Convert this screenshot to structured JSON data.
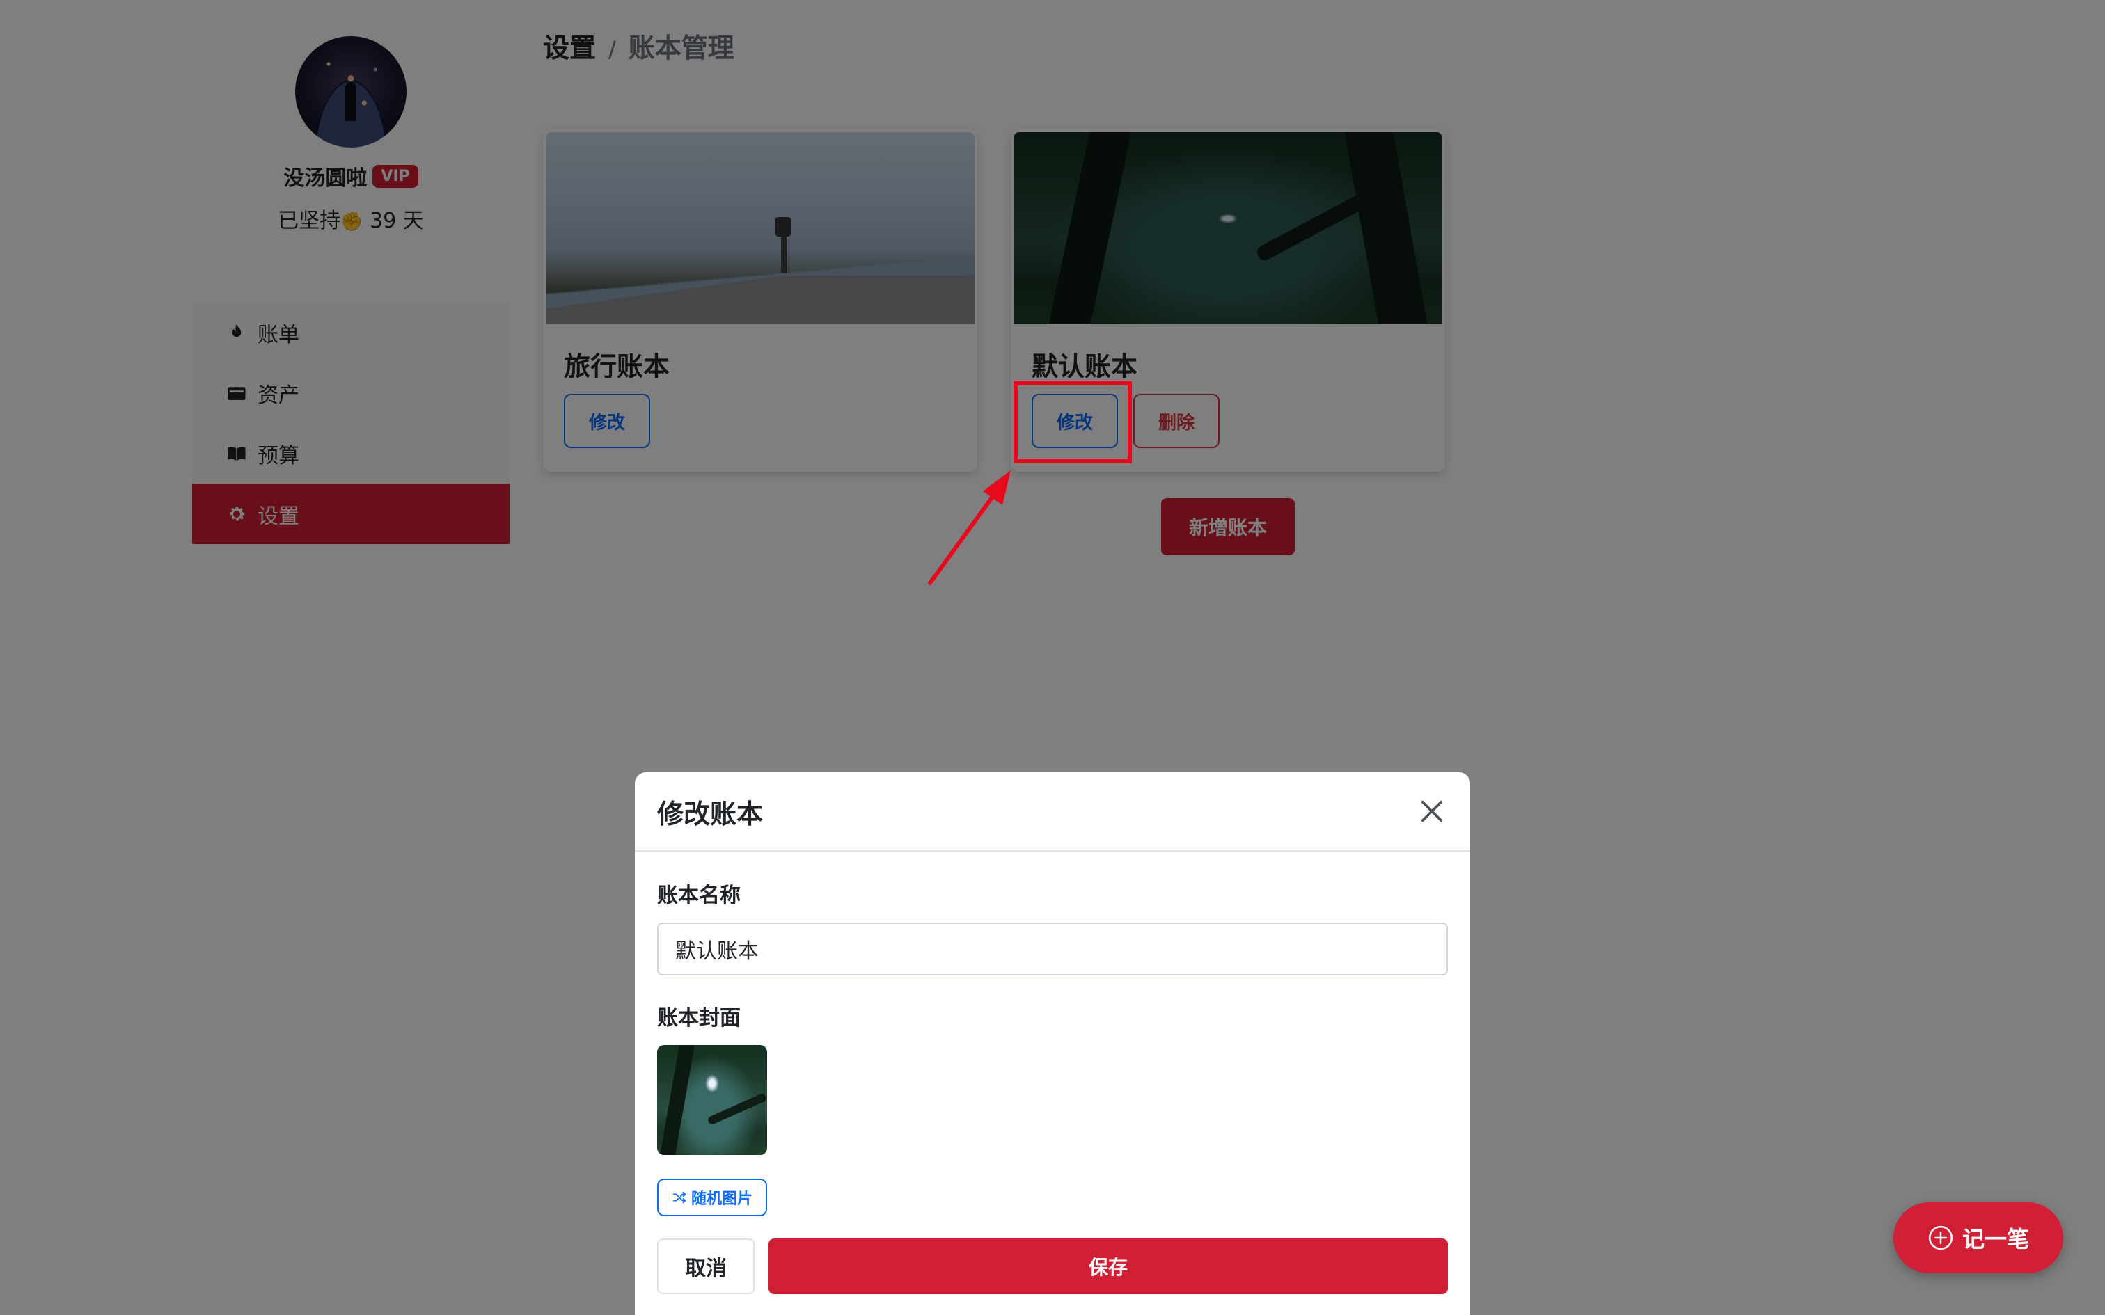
{
  "user": {
    "name": "没汤圆啦",
    "vip_label": "VIP",
    "streak_prefix": "已坚持",
    "streak_value": "39 天"
  },
  "nav": {
    "items": [
      {
        "label": "账单",
        "icon": "fire-icon"
      },
      {
        "label": "资产",
        "icon": "wallet-icon"
      },
      {
        "label": "预算",
        "icon": "book-icon"
      },
      {
        "label": "设置",
        "icon": "gear-icon",
        "active": true
      }
    ]
  },
  "breadcrumb": {
    "parent": "设置",
    "separator": "/",
    "current": "账本管理"
  },
  "books": [
    {
      "title": "旅行账本",
      "edit_label": "修改"
    },
    {
      "title": "默认账本",
      "edit_label": "修改",
      "delete_label": "删除"
    }
  ],
  "add_book_label": "新增账本",
  "modal": {
    "title": "修改账本",
    "name_label": "账本名称",
    "name_value": "默认账本",
    "cover_label": "账本封面",
    "random_label": "随机图片",
    "cancel_label": "取消",
    "save_label": "保存"
  },
  "fab_label": "记一笔",
  "colors": {
    "brand_red": "#d11f35",
    "link_blue": "#0d6efd",
    "annotation_red": "#e8091d"
  }
}
